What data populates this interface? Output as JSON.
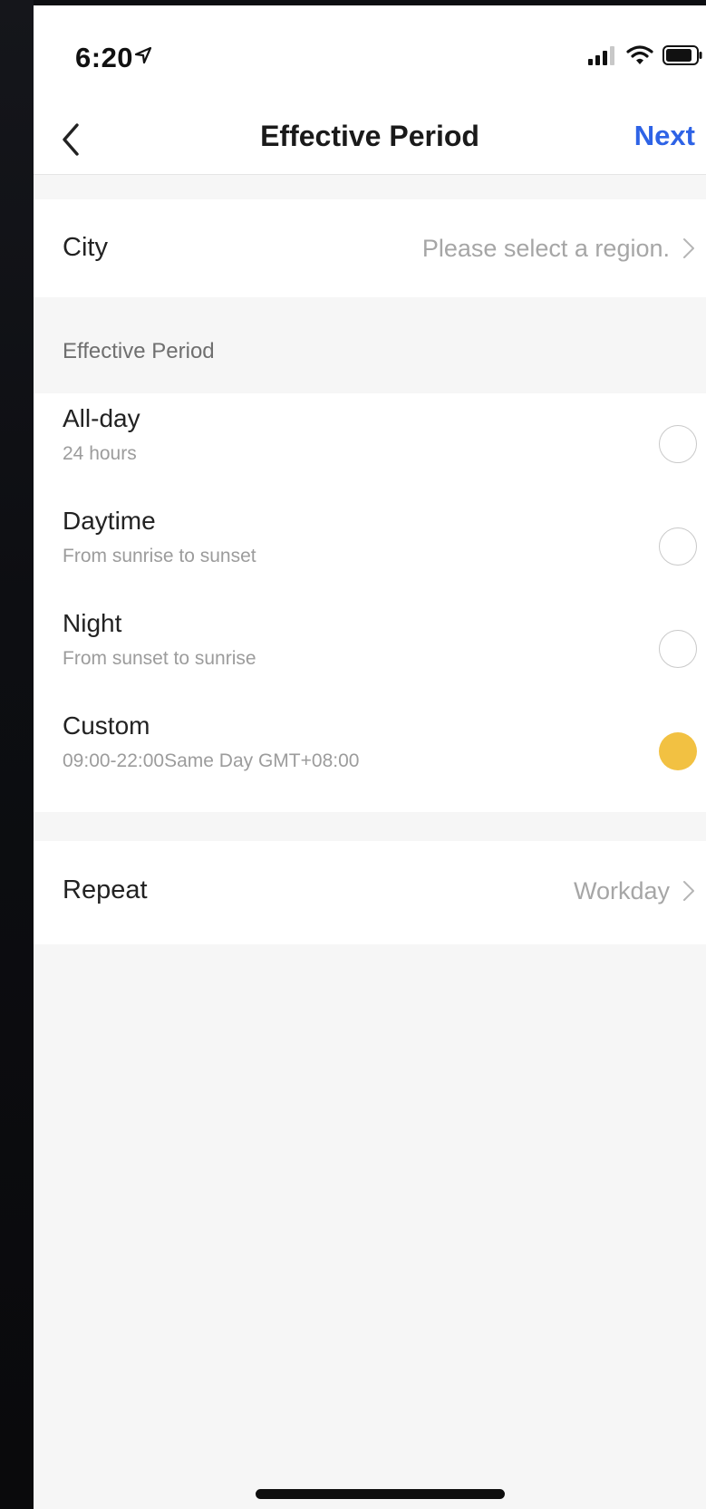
{
  "status_bar": {
    "time": "6:20",
    "location_icon": "location-arrow-icon",
    "signal_icon": "cellular-signal-icon",
    "wifi_icon": "wifi-icon",
    "battery_icon": "battery-icon"
  },
  "nav": {
    "back_icon": "chevron-left-icon",
    "title": "Effective Period",
    "next_label": "Next",
    "accent_color": "#2e63e6"
  },
  "city": {
    "label": "City",
    "value": "Please select a region."
  },
  "period_section": {
    "header": "Effective Period",
    "options": [
      {
        "title": "All-day",
        "subtitle": "24 hours",
        "selected": false
      },
      {
        "title": "Daytime",
        "subtitle": "From sunrise to sunset",
        "selected": false
      },
      {
        "title": "Night",
        "subtitle": "From sunset to sunrise",
        "selected": false
      },
      {
        "title": "Custom",
        "subtitle": "09:00-22:00Same Day GMT+08:00",
        "selected": true
      }
    ],
    "selected_color": "#f2c142"
  },
  "repeat": {
    "label": "Repeat",
    "value": "Workday"
  }
}
